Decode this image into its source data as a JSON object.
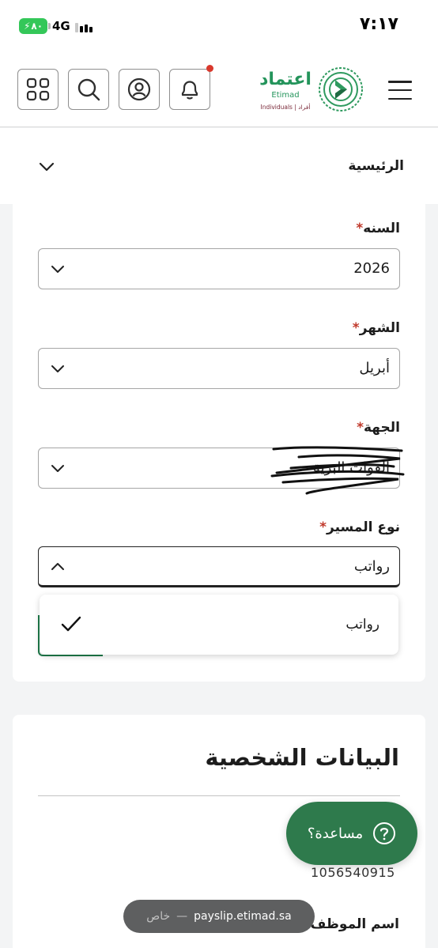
{
  "status_bar": {
    "time": "٧:١٧",
    "battery": "٨٠",
    "network": "4G"
  },
  "header": {
    "logo": {
      "arabic": "اعتماد",
      "english": "Etimad",
      "subtitle": "Individuals | أفراد"
    },
    "icons": [
      "menu-icon",
      "apps-grid-icon",
      "search-icon",
      "user-icon",
      "bell-icon"
    ],
    "notification_dot_color": "#d9382c"
  },
  "breadcrumb": {
    "label": "الرئيسية"
  },
  "form": {
    "required_marker": "*",
    "year": {
      "label": "السنه",
      "value": "2026"
    },
    "month": {
      "label": "الشهر",
      "value": "أبريل"
    },
    "entity": {
      "label": "الجهة",
      "value": "القوات البرية"
    },
    "payslip_type": {
      "label": "نوع المسير",
      "value": "رواتب"
    }
  },
  "dropdown": {
    "options": [
      {
        "label": "رواتب",
        "selected": true
      }
    ]
  },
  "personal": {
    "title": "البيانات الشخصية",
    "employee_id": "1056540915",
    "employee_name_label": "اسم الموظف"
  },
  "help": {
    "label": "مساعدة؟"
  },
  "url_bar": {
    "domain": "payslip.etimad.sa",
    "separator": "—",
    "mode": "خاص"
  },
  "colors": {
    "brand_green": "#24945b",
    "fab_green": "#2e7a4c",
    "required_red": "#c0392b",
    "battery_green": "#34c759"
  }
}
